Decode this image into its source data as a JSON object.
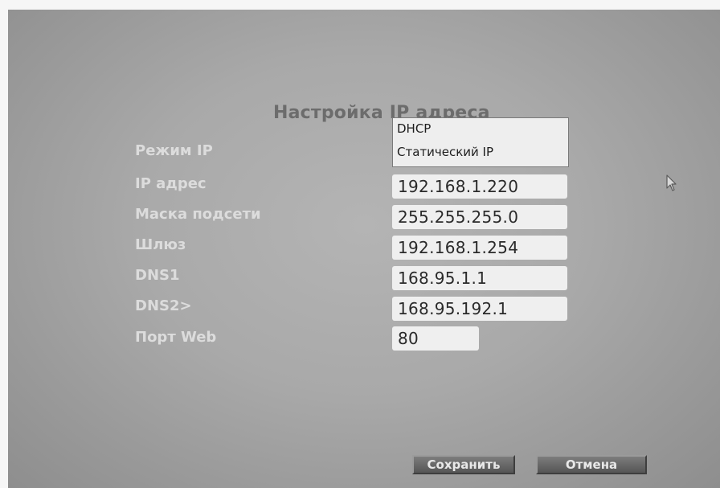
{
  "dialog": {
    "title": "Настройка IP адреса"
  },
  "form": {
    "ip_mode_label": "Режим IP",
    "ip_address_label": "IP адрес",
    "subnet_mask_label": "Маска подсети",
    "gateway_label": "Шлюз",
    "dns1_label": "DNS1",
    "dns2_label": "DNS2>",
    "web_port_label": "Порт Web",
    "ip_address_value": "192.168.1.220",
    "subnet_mask_value": "255.255.255.0",
    "gateway_value": "192.168.1.254",
    "dns1_value": "168.95.1.1",
    "dns2_value": "168.95.192.1",
    "web_port_value": "80"
  },
  "ip_mode_dropdown": {
    "options": [
      "DHCP",
      "Статический IP"
    ]
  },
  "buttons": {
    "save_label": "Сохранить",
    "cancel_label": "Отмена"
  },
  "colors": {
    "background": "#a9a9a9",
    "label_text": "#dcdcdc",
    "title_text": "#6c6c6c",
    "field_background": "#efefef",
    "button_background": "#5f5f5f"
  },
  "icons": {
    "pointer": "mouse-pointer-icon"
  }
}
